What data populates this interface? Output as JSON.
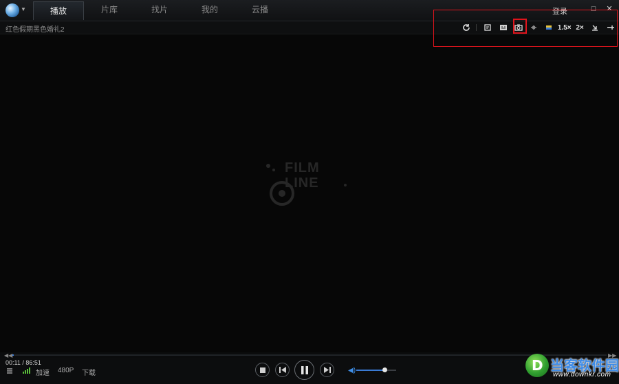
{
  "app": {
    "tabs": [
      "播放",
      "片库",
      "找片",
      "我的",
      "云播"
    ],
    "active_tab": "播放",
    "login": "登录",
    "window_buttons": [
      "□",
      "✕"
    ]
  },
  "video": {
    "title": "红色假期黑色婚礼2",
    "watermark_line1": "FILM",
    "watermark_line2": "LINE"
  },
  "toolbar": {
    "speed1": "1.5×",
    "speed2": "2×",
    "icons": [
      "refresh-icon",
      "info-icon",
      "subtitle-icon",
      "screenshot-icon",
      "lock-icon",
      "color-icon",
      "speed-1-5x-icon",
      "speed-2x-icon",
      "download-icon",
      "pin-icon"
    ]
  },
  "playback": {
    "timecode": "00:11 / 86:51",
    "progress_fraction": 0.002,
    "network": "加速",
    "quality": "480P",
    "download": "下载",
    "volume_fraction": 0.7
  },
  "branding": {
    "name": "当客软件园",
    "url": "www.downkr.com",
    "logo_letter": "D"
  },
  "colors": {
    "accent": "#3a7bd5",
    "highlight": "#e0141c",
    "signal": "#5abf3a"
  }
}
